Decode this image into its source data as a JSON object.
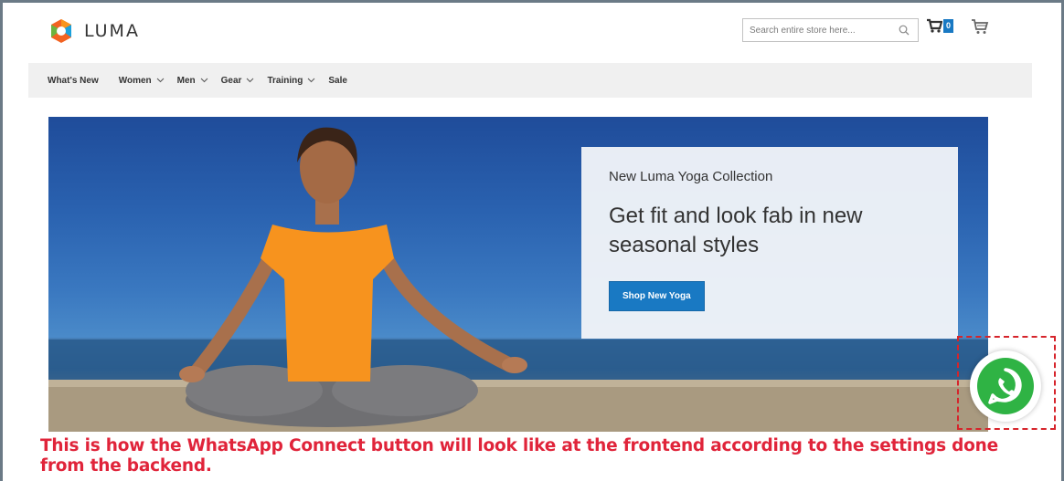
{
  "brand": {
    "name": "LUMA"
  },
  "search": {
    "placeholder": "Search entire store here..."
  },
  "compare": {
    "count": "0"
  },
  "nav": {
    "items": [
      {
        "label": "What's New",
        "has_dropdown": false
      },
      {
        "label": "Women",
        "has_dropdown": true
      },
      {
        "label": "Men",
        "has_dropdown": true
      },
      {
        "label": "Gear",
        "has_dropdown": true
      },
      {
        "label": "Training",
        "has_dropdown": true
      },
      {
        "label": "Sale",
        "has_dropdown": false
      }
    ]
  },
  "hero": {
    "subtitle": "New Luma Yoga Collection",
    "title": "Get fit and look fab in new seasonal styles",
    "button_label": "Shop New Yoga"
  },
  "whatsapp": {
    "icon": "whatsapp-icon",
    "color": "#2fb344"
  },
  "caption": {
    "text": "This is how the WhatsApp Connect button will look like at the frontend according to the settings done from the backend."
  },
  "colors": {
    "accent": "#1979c3",
    "caption": "#e0243a",
    "highlight_border": "#d6242b"
  }
}
